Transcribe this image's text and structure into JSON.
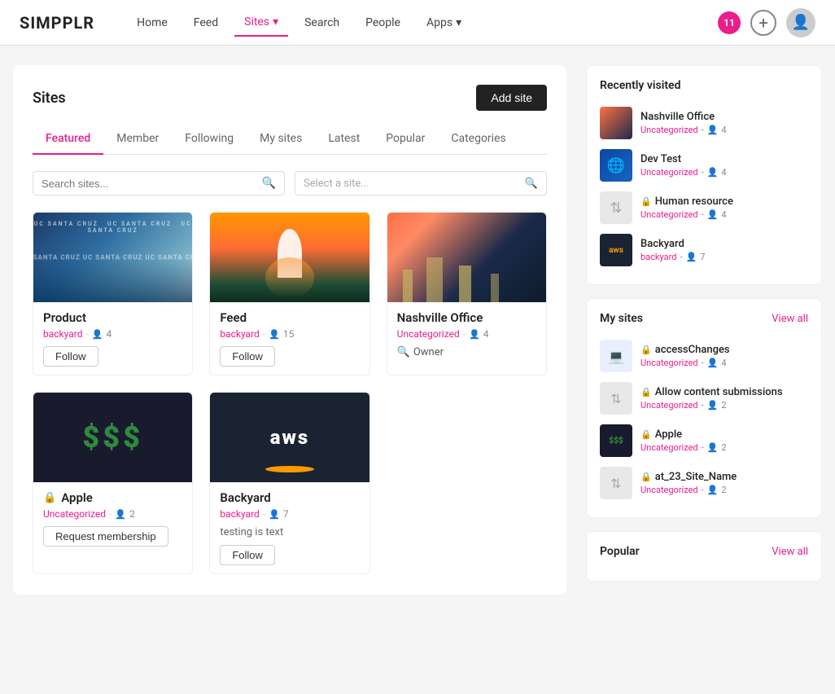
{
  "app": {
    "logo": "SIMPPLR",
    "nav_items": [
      {
        "label": "Home",
        "active": false
      },
      {
        "label": "Feed",
        "active": false
      },
      {
        "label": "Sites",
        "active": true,
        "has_dropdown": true
      },
      {
        "label": "Search",
        "active": false
      },
      {
        "label": "People",
        "active": false
      },
      {
        "label": "Apps",
        "active": false,
        "has_dropdown": true
      }
    ],
    "notification_count": "11"
  },
  "page": {
    "title": "Sites",
    "add_site_label": "Add site"
  },
  "tabs": [
    {
      "label": "Featured",
      "active": true
    },
    {
      "label": "Member",
      "active": false
    },
    {
      "label": "Following",
      "active": false
    },
    {
      "label": "My sites",
      "active": false
    },
    {
      "label": "Latest",
      "active": false
    },
    {
      "label": "Popular",
      "active": false
    },
    {
      "label": "Categories",
      "active": false
    }
  ],
  "search": {
    "placeholder": "Search sites...",
    "select_placeholder": "Select a site..."
  },
  "sites": [
    {
      "name": "Product",
      "category": "backyard",
      "members": 4,
      "locked": false,
      "action": "follow",
      "action_label": "Follow",
      "image_type": "product"
    },
    {
      "name": "Feed",
      "category": "backyard",
      "members": 15,
      "locked": false,
      "action": "follow",
      "action_label": "Follow",
      "image_type": "feed"
    },
    {
      "name": "Nashville Office",
      "category": "Uncategorized",
      "members": 4,
      "locked": false,
      "action": "owner",
      "action_label": "Owner",
      "image_type": "nashville"
    },
    {
      "name": "Apple",
      "category": "Uncategorized",
      "members": 2,
      "locked": true,
      "action": "request",
      "action_label": "Request membership",
      "image_type": "money"
    },
    {
      "name": "Backyard",
      "category": "backyard",
      "members": 7,
      "locked": false,
      "action": "follow",
      "action_label": "Follow",
      "description": "testing is text",
      "image_type": "aws"
    }
  ],
  "sidebar": {
    "recently_visited_title": "Recently visited",
    "recently_visited": [
      {
        "name": "Nashville Office",
        "category": "Uncategorized",
        "members": 4,
        "image_type": "nashville",
        "locked": false
      },
      {
        "name": "Dev Test",
        "category": "Uncategorized",
        "members": 4,
        "image_type": "devtest",
        "locked": false
      },
      {
        "name": "Human resource",
        "category": "Uncategorized",
        "members": 4,
        "image_type": "default",
        "locked": true
      },
      {
        "name": "Backyard",
        "category": "backyard",
        "members": 7,
        "image_type": "aws",
        "locked": false
      }
    ],
    "my_sites_title": "My sites",
    "view_all_label": "View all",
    "my_sites": [
      {
        "name": "accessChanges",
        "category": "Uncategorized",
        "members": 4,
        "image_type": "laptop",
        "locked": true
      },
      {
        "name": "Allow content submissions",
        "category": "Uncategorized",
        "members": 2,
        "image_type": "default",
        "locked": true
      },
      {
        "name": "Apple",
        "category": "Uncategorized",
        "members": 2,
        "image_type": "money",
        "locked": true
      },
      {
        "name": "at_23_Site_Name",
        "category": "Uncategorized",
        "members": 2,
        "image_type": "default",
        "locked": true
      }
    ],
    "popular_title": "Popular",
    "popular_view_all": "View all"
  }
}
